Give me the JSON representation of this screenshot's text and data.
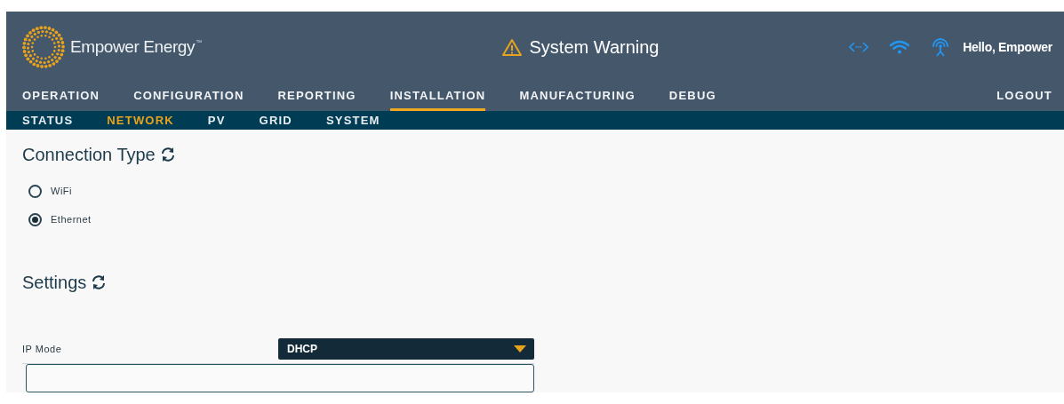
{
  "header": {
    "brand": "Empower Energy",
    "trademark": "™",
    "warning": "System Warning",
    "greeting": "Hello, Empower"
  },
  "main_nav": [
    {
      "label": "OPERATION",
      "selected": false
    },
    {
      "label": "CONFIGURATION",
      "selected": false
    },
    {
      "label": "REPORTING",
      "selected": false
    },
    {
      "label": "INSTALLATION",
      "selected": true
    },
    {
      "label": "MANUFACTURING",
      "selected": false
    },
    {
      "label": "DEBUG",
      "selected": false
    }
  ],
  "logout": "LOGOUT",
  "sub_nav": [
    {
      "label": "STATUS",
      "selected": false
    },
    {
      "label": "NETWORK",
      "selected": true
    },
    {
      "label": "PV",
      "selected": false
    },
    {
      "label": "GRID",
      "selected": false
    },
    {
      "label": "SYSTEM",
      "selected": false
    }
  ],
  "connection_type": {
    "title": "Connection Type",
    "options": [
      {
        "label": "WiFi",
        "selected": false
      },
      {
        "label": "Ethernet",
        "selected": true
      }
    ]
  },
  "settings": {
    "title": "Settings",
    "ip_mode": {
      "label": "IP Mode",
      "value": "DHCP"
    }
  }
}
